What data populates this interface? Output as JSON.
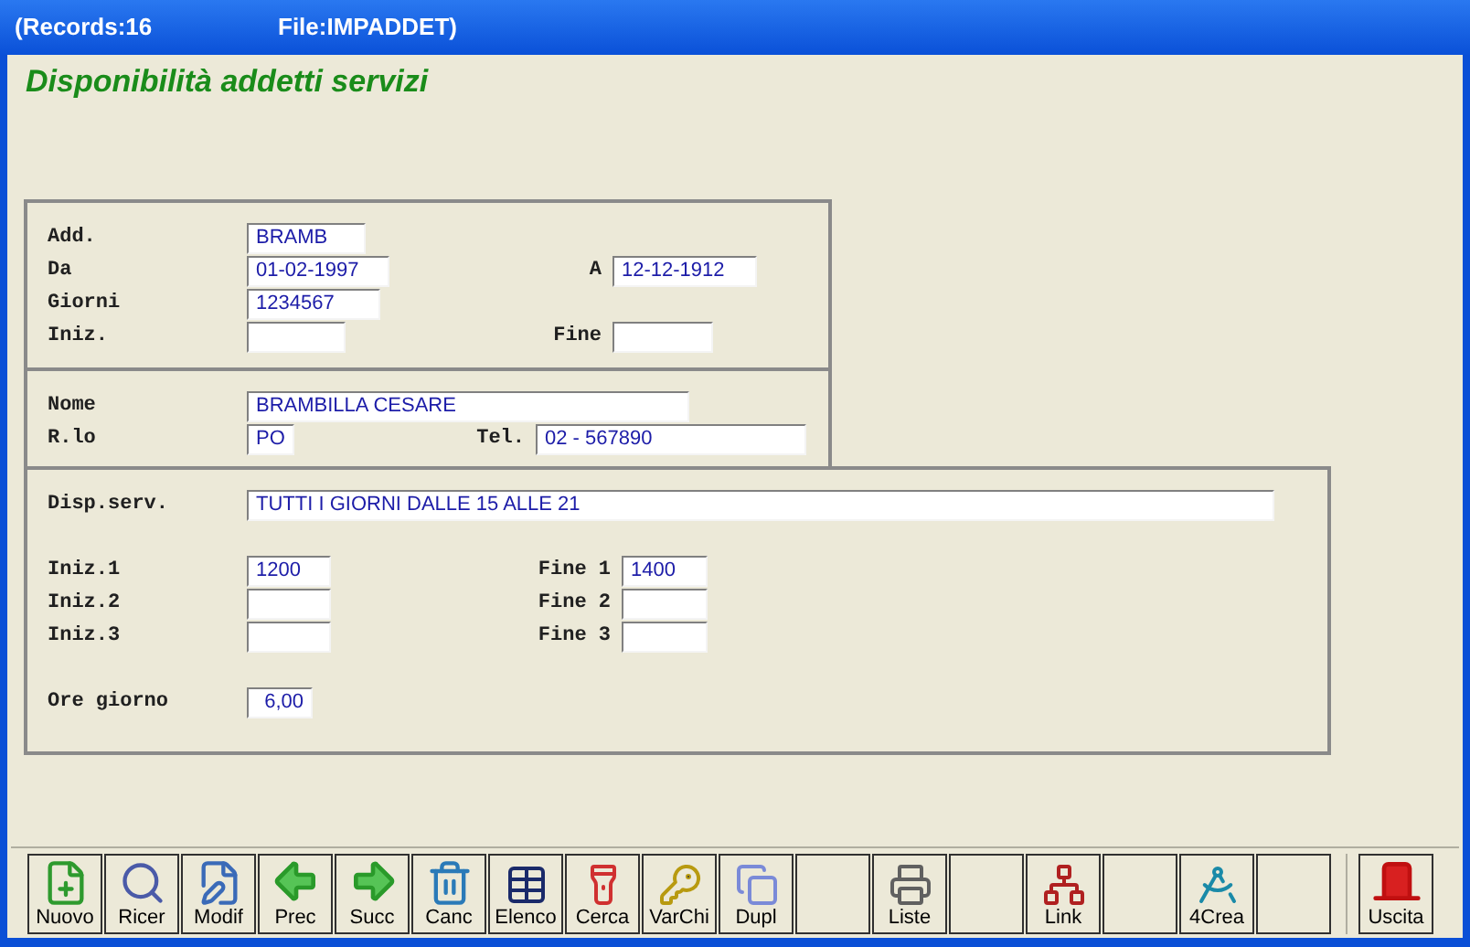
{
  "title_bar": {
    "records": "(Records:16",
    "file": "File:IMPADDET)"
  },
  "heading": "Disponibilità addetti servizi",
  "sections": [
    {
      "rows": [
        {
          "fields": [
            {
              "label": "Add.",
              "value": "BRAMB"
            }
          ]
        },
        {
          "fields": [
            {
              "label": "Da",
              "value": "01-02-1997"
            },
            {
              "label": "A",
              "value": "12-12-1912"
            }
          ]
        },
        {
          "fields": [
            {
              "label": "Giorni",
              "value": "1234567"
            }
          ]
        },
        {
          "fields": [
            {
              "label": "Iniz."
            },
            {
              "label": "Fine"
            }
          ]
        }
      ]
    },
    {
      "rows": [
        {
          "fields": [
            {
              "label": "Nome",
              "value": "BRAMBILLA CESARE"
            }
          ]
        },
        {
          "fields": [
            {
              "label": "R.lo",
              "value": "PO"
            },
            {
              "label": "Tel.",
              "value": "02 - 567890"
            }
          ]
        }
      ]
    },
    {
      "rows": [
        {
          "fields": [
            {
              "label": "Disp.serv.",
              "value": "TUTTI I GIORNI DALLE 15 ALLE 21"
            }
          ]
        },
        {
          "fields": [
            {
              "label": "Iniz.1",
              "value": "1200"
            },
            {
              "label": "Fine 1",
              "value": "1400"
            }
          ]
        },
        {
          "fields": [
            {
              "label": "Iniz.2"
            },
            {
              "label": "Fine 2"
            }
          ]
        },
        {
          "fields": [
            {
              "label": "Iniz.3"
            },
            {
              "label": "Fine 3"
            }
          ]
        },
        {
          "fields": [
            {
              "label": "Ore giorno",
              "value": "6,00"
            }
          ]
        }
      ]
    }
  ],
  "toolbar": [
    {
      "kind": "button",
      "label": "Nuovo"
    },
    {
      "kind": "button",
      "label": "Ricer"
    },
    {
      "kind": "button",
      "label": "Modif"
    },
    {
      "kind": "button",
      "label": "Prec"
    },
    {
      "kind": "button",
      "label": "Succ"
    },
    {
      "kind": "button",
      "label": "Canc"
    },
    {
      "kind": "button",
      "label": "Elenco"
    },
    {
      "kind": "button",
      "label": "Cerca"
    },
    {
      "kind": "button",
      "label": "VarChi"
    },
    {
      "kind": "button",
      "label": "Dupl"
    },
    {
      "kind": "blank"
    },
    {
      "kind": "button",
      "label": "Liste"
    },
    {
      "kind": "blank"
    },
    {
      "kind": "button",
      "label": "Link"
    },
    {
      "kind": "blank"
    },
    {
      "kind": "button",
      "label": "4Crea"
    },
    {
      "kind": "blank"
    },
    {
      "kind": "exit",
      "label": "Uscita"
    }
  ]
}
